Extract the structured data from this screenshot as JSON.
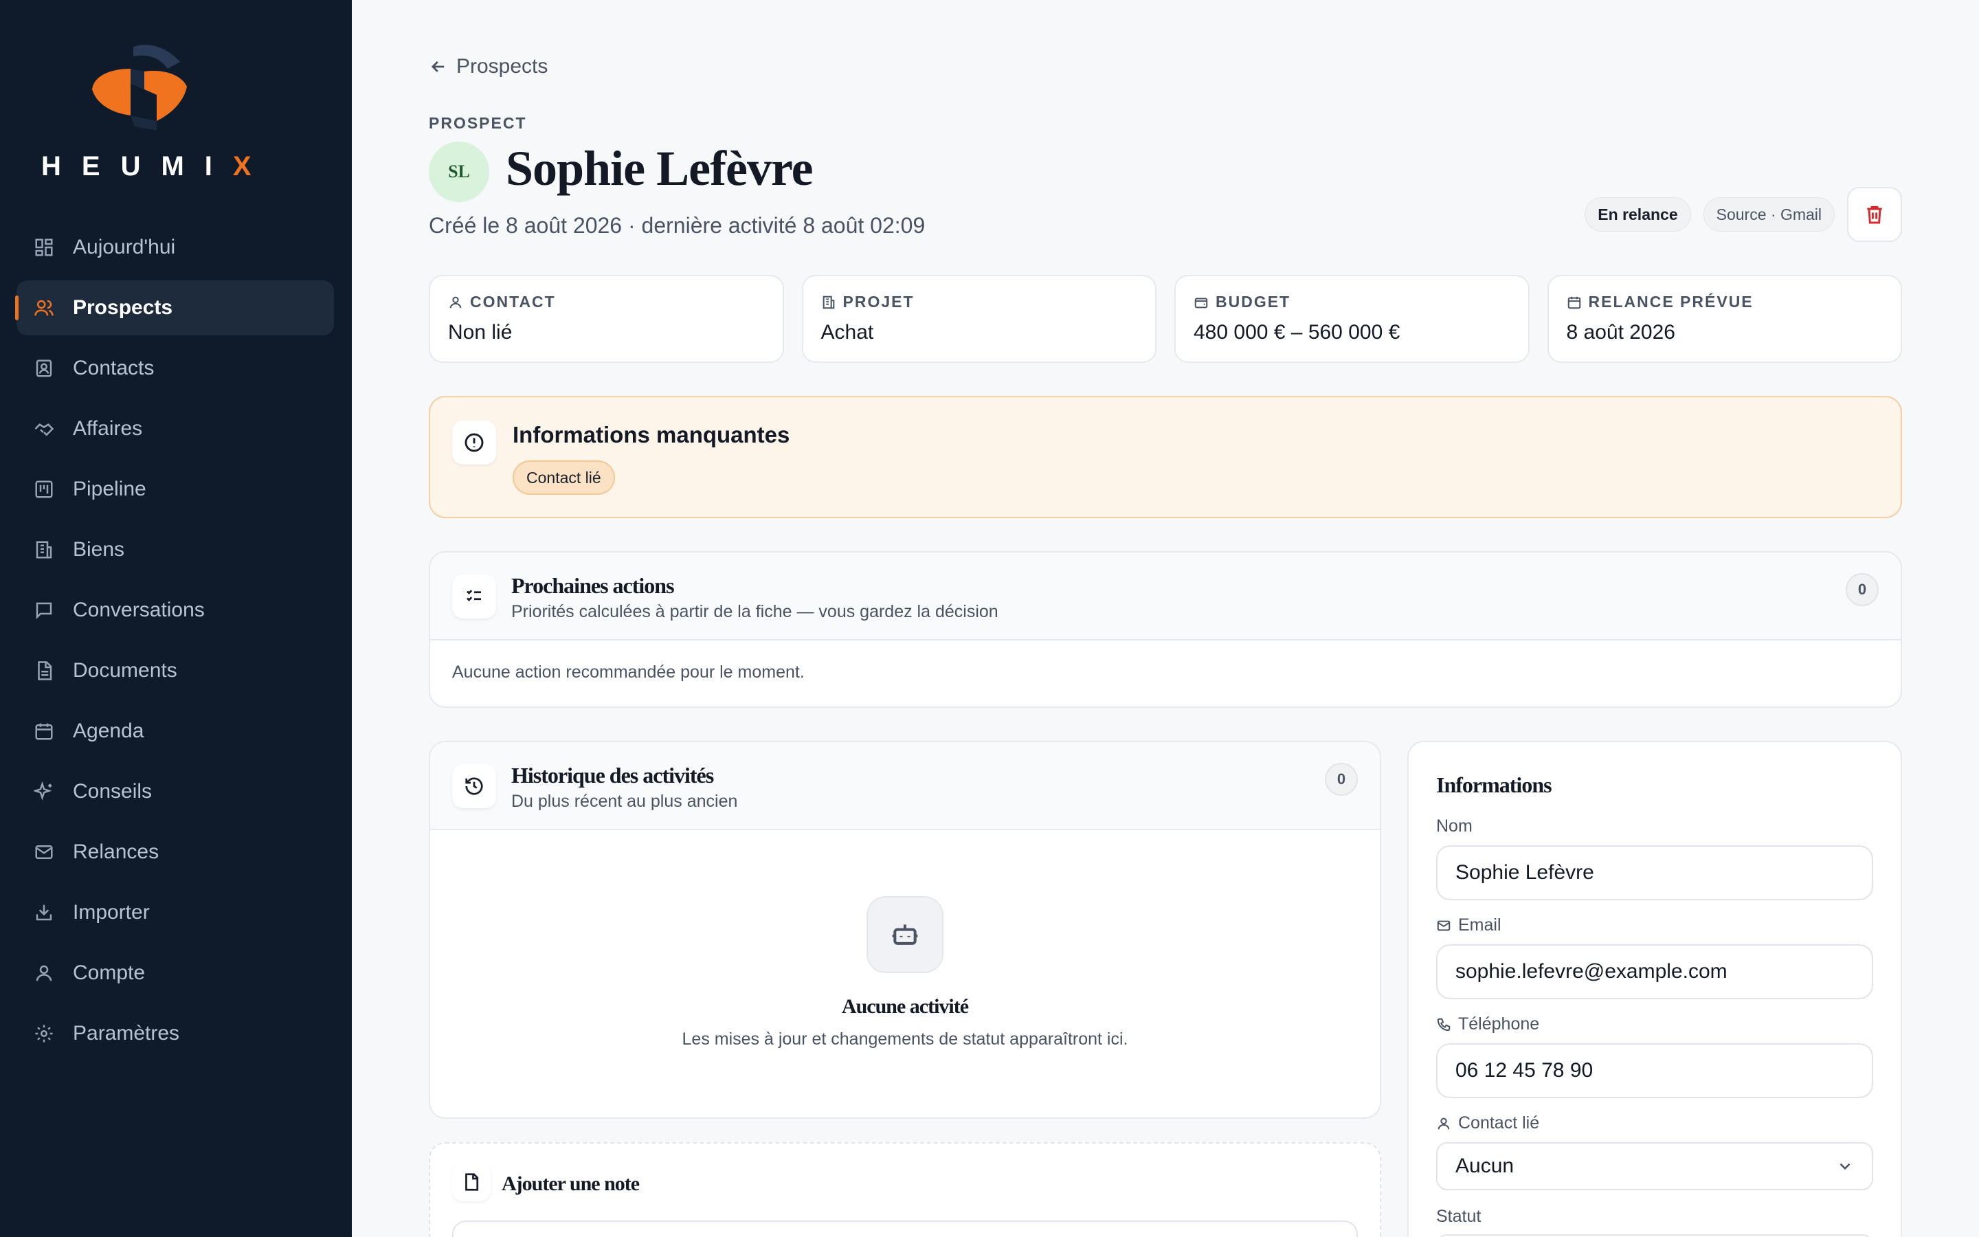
{
  "brand": {
    "name_main": "HEUMI",
    "name_accent": "X",
    "accent_color": "#f0731f",
    "sidebar_bg": "#0f1b2b"
  },
  "nav": [
    {
      "label": "Aujourd'hui",
      "icon": "dashboard-icon",
      "active": false
    },
    {
      "label": "Prospects",
      "icon": "users-icon",
      "active": true
    },
    {
      "label": "Contacts",
      "icon": "contact-card-icon",
      "active": false
    },
    {
      "label": "Affaires",
      "icon": "handshake-icon",
      "active": false
    },
    {
      "label": "Pipeline",
      "icon": "kanban-icon",
      "active": false
    },
    {
      "label": "Biens",
      "icon": "building-icon",
      "active": false
    },
    {
      "label": "Conversations",
      "icon": "message-icon",
      "active": false
    },
    {
      "label": "Documents",
      "icon": "document-icon",
      "active": false
    },
    {
      "label": "Agenda",
      "icon": "calendar-icon",
      "active": false
    },
    {
      "label": "Conseils",
      "icon": "sparkles-icon",
      "active": false
    },
    {
      "label": "Relances",
      "icon": "mail-icon",
      "active": false
    },
    {
      "label": "Importer",
      "icon": "import-icon",
      "active": false
    },
    {
      "label": "Compte",
      "icon": "user-icon",
      "active": false
    },
    {
      "label": "Paramètres",
      "icon": "gear-icon",
      "active": false
    }
  ],
  "header": {
    "back_label": "Prospects",
    "eyebrow": "PROSPECT",
    "avatar_initials": "SL",
    "name": "Sophie Lefèvre",
    "subtitle": "Créé le 8 août 2026 · dernière activité 8 août 02:09",
    "status_badge": "En relance",
    "source_badge": "Source · Gmail"
  },
  "stats": [
    {
      "label": "CONTACT",
      "value": "Non lié",
      "icon": "user-icon"
    },
    {
      "label": "PROJET",
      "value": "Achat",
      "icon": "building-icon"
    },
    {
      "label": "BUDGET",
      "value": "480 000 € – 560 000 €",
      "icon": "wallet-icon"
    },
    {
      "label": "RELANCE PRÉVUE",
      "value": "8 août 2026",
      "icon": "calendar-icon"
    }
  ],
  "missing": {
    "title": "Informations manquantes",
    "chips": [
      "Contact lié"
    ]
  },
  "next_actions": {
    "title": "Prochaines actions",
    "subtitle": "Priorités calculées à partir de la fiche — vous gardez la décision",
    "count": "0",
    "empty_text": "Aucune action recommandée pour le moment."
  },
  "history": {
    "title": "Historique des activités",
    "subtitle": "Du plus récent au plus ancien",
    "count": "0",
    "empty_title": "Aucune activité",
    "empty_subtitle": "Les mises à jour et changements de statut apparaîtront ici."
  },
  "note": {
    "title": "Ajouter une note"
  },
  "info": {
    "title": "Informations",
    "name_label": "Nom",
    "name_value": "Sophie Lefèvre",
    "email_label": "Email",
    "email_value": "sophie.lefevre@example.com",
    "phone_label": "Téléphone",
    "phone_value": "06 12 45 78 90",
    "contact_label": "Contact lié",
    "contact_value": "Aucun",
    "status_label": "Statut"
  }
}
